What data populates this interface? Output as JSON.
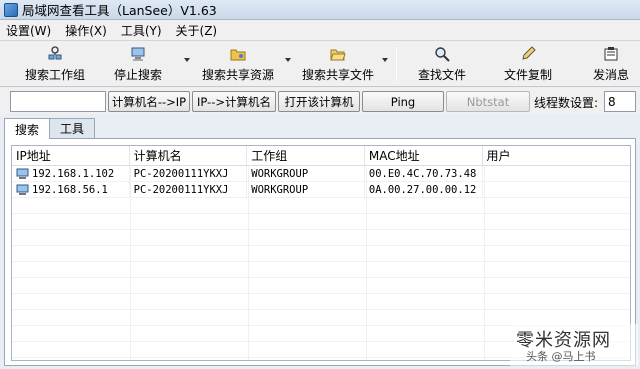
{
  "window": {
    "title": "局域网查看工具（LanSee）V1.63"
  },
  "menu": [
    "设置(W)",
    "操作(X)",
    "工具(Y)",
    "关于(Z)"
  ],
  "toolbar": {
    "search_workgroup": "搜索工作组",
    "stop_search": "停止搜索",
    "search_share": "搜索共享资源",
    "search_share_file": "搜索共享文件",
    "find_file": "查找文件",
    "copy_file": "文件复制",
    "send_message": "发消息"
  },
  "actions": {
    "input_value": "",
    "name_to_ip": "计算机名-->IP",
    "ip_to_name": "IP-->计算机名",
    "open_computer": "打开该计算机",
    "ping": "Ping",
    "nbtstat": "Nbtstat",
    "thread_label": "线程数设置:",
    "thread_value": "8"
  },
  "tabs": [
    "搜索",
    "工具"
  ],
  "table": {
    "columns": [
      "IP地址",
      "计算机名",
      "工作组",
      "MAC地址",
      "用户"
    ],
    "rows": [
      [
        "192.168.1.102",
        "PC-20200111YKXJ",
        "WORKGROUP",
        "00.E0.4C.70.73.48",
        ""
      ],
      [
        "192.168.56.1",
        "PC-20200111YKXJ",
        "WORKGROUP",
        "0A.00.27.00.00.12",
        ""
      ]
    ]
  },
  "watermark": {
    "text": "零米资源网",
    "sub": "头条 @马上书"
  }
}
